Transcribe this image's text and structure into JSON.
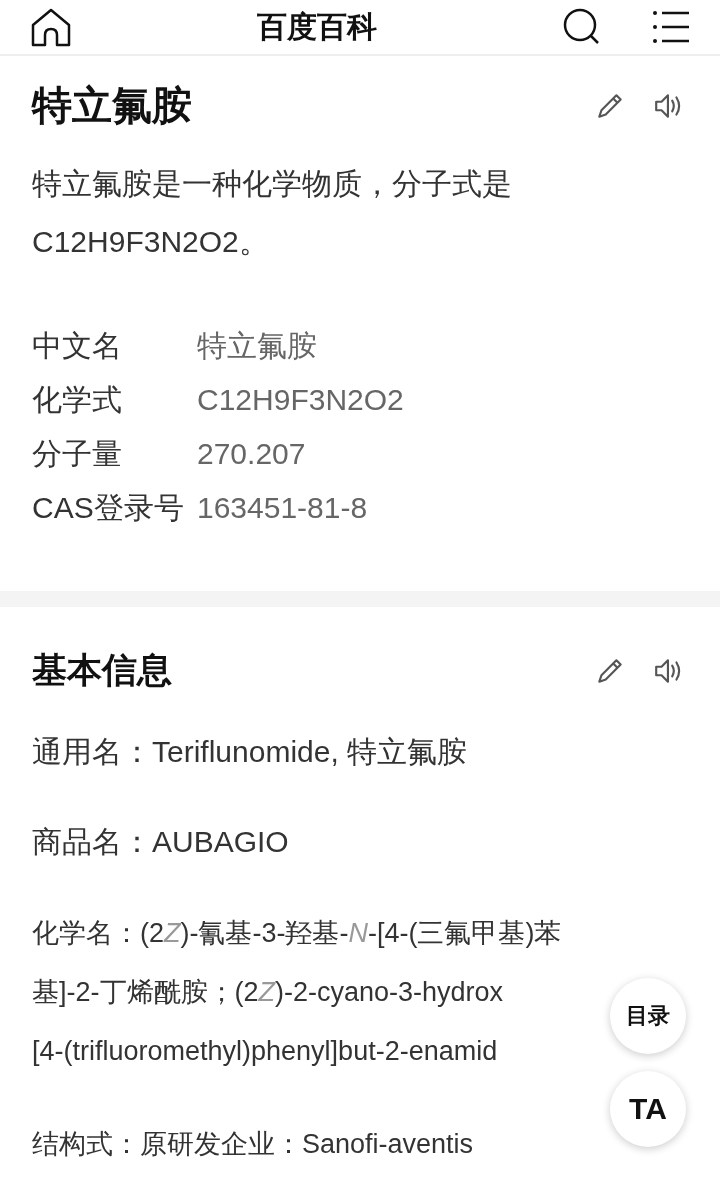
{
  "header": {
    "title": "百度百科"
  },
  "article": {
    "title": "特立氟胺",
    "summary": "特立氟胺是一种化学物质，分子式是C12H9F3N2O2。",
    "facts": [
      {
        "label": "中文名",
        "value": "特立氟胺"
      },
      {
        "label": "化学式",
        "value": "C12H9F3N2O2"
      },
      {
        "label": "分子量",
        "value": "270.207"
      },
      {
        "label": "CAS登录号",
        "value": "163451-81-8"
      }
    ]
  },
  "section": {
    "title": "基本信息",
    "paragraphs": [
      "通用名：Teriflunomide, 特立氟胺",
      "商品名：AUBAGIO",
      [
        {
          "text": "化学名：(2",
          "italic": false
        },
        {
          "text": "Z",
          "italic": true
        },
        {
          "text": ")-氰基-3-羟基-",
          "italic": false
        },
        {
          "text": "N",
          "italic": true
        },
        {
          "text": "-[4-(三氟甲基)苯基]-2-丁烯酰胺；(2",
          "italic": false
        },
        {
          "text": "Z",
          "italic": true
        },
        {
          "text": ")-2-cyano-3-hydrox",
          "italic": false
        }
      ],
      "[4-(trifluoromethyl)phenyl]but-2-enamid",
      "结构式：原研发企业：Sanofi-aventis"
    ]
  },
  "floating_buttons": [
    "目录",
    "TA"
  ]
}
